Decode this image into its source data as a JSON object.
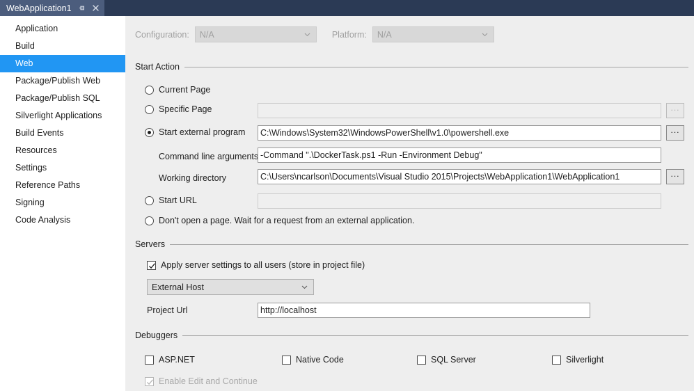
{
  "tab": {
    "title": "WebApplication1",
    "pin_icon": "pin-icon",
    "close_icon": "close-icon"
  },
  "sidebar": {
    "items": [
      {
        "label": "Application",
        "state": "normal"
      },
      {
        "label": "Build",
        "state": "normal"
      },
      {
        "label": "Web",
        "state": "selected"
      },
      {
        "label": "Package/Publish Web",
        "state": "hovered"
      },
      {
        "label": "Package/Publish SQL",
        "state": "normal"
      },
      {
        "label": "Silverlight Applications",
        "state": "normal"
      },
      {
        "label": "Build Events",
        "state": "normal"
      },
      {
        "label": "Resources",
        "state": "normal"
      },
      {
        "label": "Settings",
        "state": "normal"
      },
      {
        "label": "Reference Paths",
        "state": "normal"
      },
      {
        "label": "Signing",
        "state": "normal"
      },
      {
        "label": "Code Analysis",
        "state": "normal"
      }
    ]
  },
  "toolbar": {
    "configuration_label": "Configuration:",
    "configuration_value": "N/A",
    "platform_label": "Platform:",
    "platform_value": "N/A"
  },
  "start_action": {
    "group_label": "Start Action",
    "current_page_label": "Current Page",
    "specific_page_label": "Specific Page",
    "specific_page_value": "",
    "start_external_program_label": "Start external program",
    "start_external_program_value": "C:\\Windows\\System32\\WindowsPowerShell\\v1.0\\powershell.exe",
    "command_line_arguments_label": "Command line arguments",
    "command_line_arguments_value": "-Command \".\\DockerTask.ps1 -Run -Environment Debug\"",
    "working_directory_label": "Working directory",
    "working_directory_value": "C:\\Users\\ncarlson\\Documents\\Visual Studio 2015\\Projects\\WebApplication1\\WebApplication1",
    "start_url_label": "Start URL",
    "start_url_value": "",
    "dont_open_page_label": "Don't open a page. Wait for a request from an external application.",
    "browse_label": "..."
  },
  "servers": {
    "group_label": "Servers",
    "apply_all_users_label": "Apply server settings to all users (store in project file)",
    "server_value": "External Host",
    "project_url_label": "Project Url",
    "project_url_value": "http://localhost"
  },
  "debuggers": {
    "group_label": "Debuggers",
    "aspnet_label": "ASP.NET",
    "native_code_label": "Native Code",
    "sql_server_label": "SQL Server",
    "silverlight_label": "Silverlight",
    "enable_edit_continue_label": "Enable Edit and Continue"
  },
  "colors": {
    "tabbar_bg": "#2b3a55",
    "tab_active_bg": "#4c5d7d",
    "accent_blue": "#2196f3",
    "content_bg": "#eeeeee",
    "sidebar_bg": "#ffffff"
  }
}
